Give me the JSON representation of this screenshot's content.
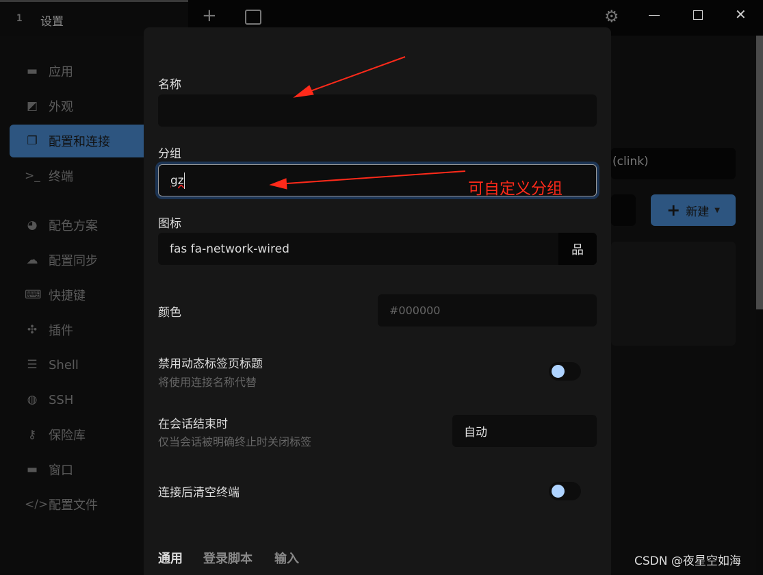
{
  "window": {
    "tab_number": "1",
    "tab_title": "设置"
  },
  "sidebar": {
    "items": [
      {
        "label": "应用",
        "icon": "window-icon"
      },
      {
        "label": "外观",
        "icon": "swatchbook-icon"
      },
      {
        "label": "配置和连接",
        "icon": "clone-icon",
        "active": true
      },
      {
        "label": "终端",
        "icon": "terminal-icon"
      },
      {
        "label": "配色方案",
        "icon": "palette-icon"
      },
      {
        "label": "配置同步",
        "icon": "cloud-icon"
      },
      {
        "label": "快捷键",
        "icon": "keyboard-icon"
      },
      {
        "label": "插件",
        "icon": "puzzle-icon"
      },
      {
        "label": "Shell",
        "icon": "list-icon"
      },
      {
        "label": "SSH",
        "icon": "globe-icon"
      },
      {
        "label": "保险库",
        "icon": "key-icon"
      },
      {
        "label": "窗口",
        "icon": "window-icon"
      },
      {
        "label": "配置文件",
        "icon": "code-icon"
      }
    ]
  },
  "background": {
    "shell_value": "(clink)",
    "new_button": "新建"
  },
  "dialog": {
    "name_label": "名称",
    "name_value": "",
    "group_label": "分组",
    "group_value": "gz",
    "icon_label": "图标",
    "icon_value": "fas fa-network-wired",
    "color_label": "颜色",
    "color_placeholder": "#000000",
    "disable_dynamic_title": {
      "label": "禁用动态标签页标题",
      "desc": "将使用连接名称代替",
      "on": false
    },
    "on_session_end": {
      "label": "在会话结束时",
      "desc": "仅当会话被明确终止时关闭标签",
      "value": "自动"
    },
    "clear_terminal": {
      "label": "连接后清空终端",
      "on": false
    },
    "tabs": [
      "通用",
      "登录脚本",
      "输入"
    ],
    "active_tab": "通用"
  },
  "annotation": {
    "text": "可自定义分组",
    "color": "#ff2a1a"
  },
  "watermark": "CSDN @夜星空如海",
  "colors": {
    "accent": "#2d5580",
    "toggle_knob": "#aed3ff"
  }
}
